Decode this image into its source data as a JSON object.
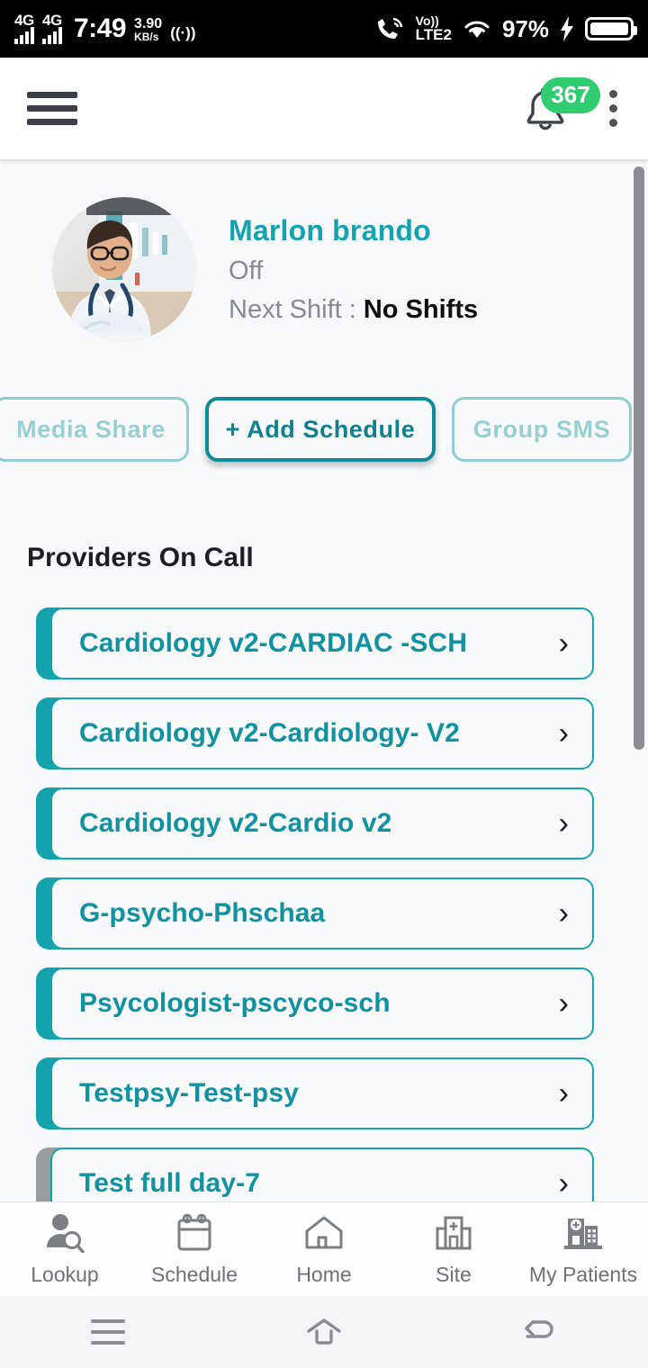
{
  "status_bar": {
    "network_1": "4G",
    "network_2": "4G",
    "time": "7:49",
    "data_speed_value": "3.90",
    "data_speed_unit": "KB/s",
    "hotspot_icon": "((·))",
    "call_icon": "call-signal-icon",
    "volte_top": "Vo))",
    "volte_bottom": "LTE2",
    "wifi_icon": "wifi-icon",
    "battery_percent": "97%",
    "charging_icon": "bolt-icon"
  },
  "app_bar": {
    "menu_icon": "hamburger-menu-icon",
    "bell_icon": "notification-bell-icon",
    "notification_count": "367",
    "overflow_icon": "kebab-menu-icon"
  },
  "profile": {
    "avatar_alt": "doctor-avatar",
    "name": "Marlon brando",
    "status": "Off",
    "next_shift_label": "Next Shift :",
    "next_shift_value": "No Shifts"
  },
  "actions": [
    {
      "label": "Media Share",
      "state": "disabled"
    },
    {
      "label": "+ Add Schedule",
      "state": "primary"
    },
    {
      "label": "Group SMS",
      "state": "disabled"
    }
  ],
  "providers_section": {
    "title": "Providers On Call",
    "chevron_icon": "chevron-right-icon",
    "items": [
      {
        "label": "Cardiology v2-CARDIAC -SCH",
        "accent": "teal"
      },
      {
        "label": "Cardiology v2-Cardiology- V2",
        "accent": "teal"
      },
      {
        "label": "Cardiology v2-Cardio v2",
        "accent": "teal"
      },
      {
        "label": "G-psycho-Phschaa",
        "accent": "teal"
      },
      {
        "label": "Psycologist-pscyco-sch",
        "accent": "teal"
      },
      {
        "label": "Testpsy-Test-psy",
        "accent": "teal"
      },
      {
        "label": "Test full day-7",
        "accent": "gray"
      }
    ]
  },
  "bottom_tabs": [
    {
      "label": "Lookup",
      "icon": "person-search-icon"
    },
    {
      "label": "Schedule",
      "icon": "calendar-icon"
    },
    {
      "label": "Home",
      "icon": "house-icon"
    },
    {
      "label": "Site",
      "icon": "hospital-building-icon"
    },
    {
      "label": "My Patients",
      "icon": "hospital-patients-icon"
    }
  ],
  "system_nav": [
    {
      "icon": "recent-apps-icon"
    },
    {
      "icon": "home-icon"
    },
    {
      "icon": "back-icon"
    }
  ],
  "colors": {
    "teal": "#14a2ad",
    "teal_dark": "#0e8a97",
    "teal_muted": "#98cfd3",
    "badge_green": "#2fcc71",
    "background": "#f6f8fa"
  }
}
